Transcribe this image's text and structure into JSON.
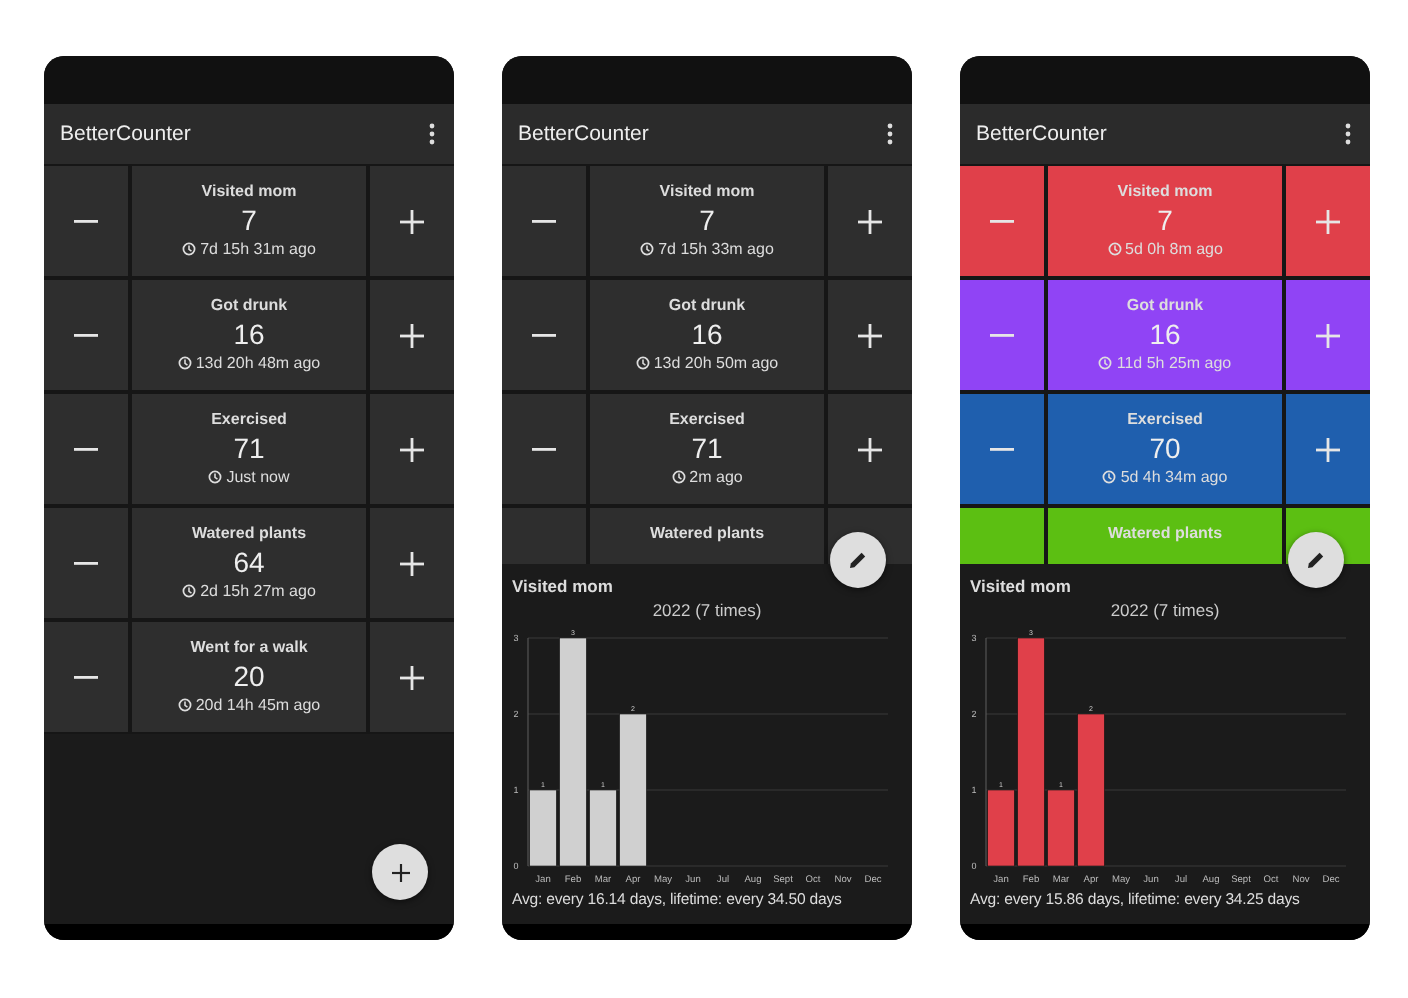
{
  "phones": [
    {
      "title": "BetterCounter",
      "counters": [
        {
          "name": "Visited mom",
          "count": "7",
          "time": "7d 15h 31m ago"
        },
        {
          "name": "Got drunk",
          "count": "16",
          "time": "13d 20h 48m ago"
        },
        {
          "name": "Exercised",
          "count": "71",
          "time": "Just now"
        },
        {
          "name": "Watered plants",
          "count": "64",
          "time": "2d 15h 27m ago"
        },
        {
          "name": "Went for a walk",
          "count": "20",
          "time": "20d 14h 45m ago"
        }
      ],
      "fab": {
        "kind": "add"
      }
    },
    {
      "title": "BetterCounter",
      "counters": [
        {
          "name": "Visited mom",
          "count": "7",
          "time": "7d 15h 33m ago"
        },
        {
          "name": "Got drunk",
          "count": "16",
          "time": "13d 20h 50m ago"
        },
        {
          "name": "Exercised",
          "count": "71",
          "time": "2m ago"
        },
        {
          "name": "Watered plants"
        }
      ],
      "fab": {
        "kind": "edit"
      },
      "sheet": {
        "heading": "Visited mom",
        "footer": "Avg: every 16.14 days, lifetime: every 34.50 days",
        "chart_data": {
          "type": "bar",
          "title": "2022 (7 times)",
          "categories": [
            "Jan",
            "Feb",
            "Mar",
            "Apr",
            "May",
            "Jun",
            "Jul",
            "Aug",
            "Sept",
            "Oct",
            "Nov",
            "Dec"
          ],
          "series": [
            {
              "color": "#d0d0d0",
              "values": [
                1,
                3,
                1,
                2,
                0,
                0,
                0,
                0,
                0,
                0,
                0,
                0
              ]
            }
          ],
          "ylim": [
            0,
            3
          ],
          "yticks": [
            0,
            1,
            2,
            3
          ],
          "value_labels": [
            "1",
            "3",
            "1",
            "2",
            null,
            null,
            null,
            null,
            null,
            null,
            null,
            null
          ]
        }
      }
    },
    {
      "title": "BetterCounter",
      "counters": [
        {
          "name": "Visited mom",
          "count": "7",
          "time": "5d 0h 8m ago",
          "color": "#e0404a"
        },
        {
          "name": "Got drunk",
          "count": "16",
          "time": "11d 5h 25m ago",
          "color": "#9044f5"
        },
        {
          "name": "Exercised",
          "count": "70",
          "time": "5d 4h 34m ago",
          "color": "#1f5fae"
        },
        {
          "name": "Watered plants",
          "color": "#5cbf12"
        }
      ],
      "fab": {
        "kind": "edit"
      },
      "sheet": {
        "heading": "Visited mom",
        "footer": "Avg: every 15.86 days, lifetime: every 34.25 days",
        "chart_data": {
          "type": "bar",
          "title": "2022 (7 times)",
          "categories": [
            "Jan",
            "Feb",
            "Mar",
            "Apr",
            "May",
            "Jun",
            "Jul",
            "Aug",
            "Sept",
            "Oct",
            "Nov",
            "Dec"
          ],
          "series": [
            {
              "color": "#e0404a",
              "values": [
                1,
                3,
                1,
                2,
                0,
                0,
                0,
                0,
                0,
                0,
                0,
                0
              ]
            }
          ],
          "ylim": [
            0,
            3
          ],
          "yticks": [
            0,
            1,
            2,
            3
          ],
          "value_labels": [
            "1",
            "3",
            "1",
            "2",
            null,
            null,
            null,
            null,
            null,
            null,
            null,
            null
          ]
        }
      }
    }
  ]
}
